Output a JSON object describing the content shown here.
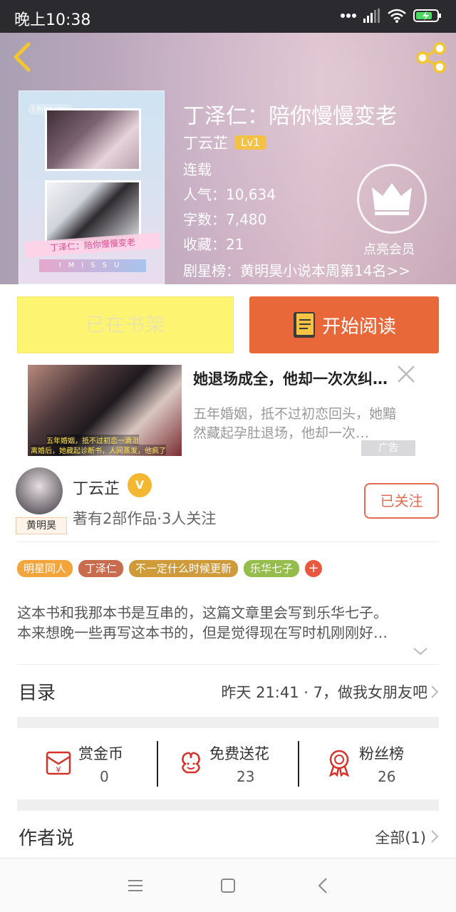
{
  "status_bar": {
    "time": "晚上10:38"
  },
  "book": {
    "title": "丁泽仁：陪你慢慢变老",
    "author": "丁云芷",
    "level": "Lv1",
    "status": "连载",
    "popularity": "人气：10,634",
    "word_count": "字数：7,480",
    "favorites": "收藏：21",
    "ranking": "剧星榜：黄明昊小说本周第14名>>",
    "vip_label": "点亮会员",
    "cover": {
      "tag": "I miss you",
      "title_strip": "丁泽仁：陪你慢慢变老",
      "letters": "IMISSU"
    }
  },
  "actions": {
    "shelf_label": "已在书架",
    "read_label": "开始阅读"
  },
  "ad": {
    "headline": "她退场成全，他却一次次纠…",
    "description": "五年婚姻，抵不过初恋回头，她黯然藏起孕肚退场，他却一次…",
    "tag": "广告",
    "caption_1": "五年婚姻，抵不过初恋一滴泪",
    "caption_2": "离婚后，她藏起诊断书，人间蒸发，他疯了"
  },
  "author_section": {
    "name": "丁云芷",
    "verified_badge": "V",
    "stats": "著有2部作品·3人关注",
    "follow_label": "已关注",
    "avatar_badge": "黄明昊"
  },
  "tags": [
    {
      "label": "明星同人",
      "color": "#f3a43b"
    },
    {
      "label": "丁泽仁",
      "color": "#c86c4d"
    },
    {
      "label": "不一定什么时候更新",
      "color": "#cf9b3a"
    },
    {
      "label": "乐华七子",
      "color": "#95bd4c"
    }
  ],
  "tag_add": "+",
  "summary": {
    "line1": "这本书和我那本书是互串的，这篇文章里会写到乐华七子。",
    "line2": "本来想晚一些再写这本书的，但是觉得现在写时机刚刚好…"
  },
  "toc": {
    "label": "目录",
    "latest": "昨天 21:41 · 7，做我女朋友吧"
  },
  "rewards": [
    {
      "label": "赏金币",
      "count": "0",
      "icon": "red-envelope-icon"
    },
    {
      "label": "免费送花",
      "count": "23",
      "icon": "flower-icon"
    },
    {
      "label": "粉丝榜",
      "count": "26",
      "icon": "medal-icon"
    }
  ],
  "author_says": {
    "label": "作者说",
    "all": "全部(1)"
  },
  "colors": {
    "accent": "#e9683a",
    "shelf_yellow": "#fdf472",
    "follow_red": "#e36c56",
    "level_badge": "#f3c144"
  }
}
